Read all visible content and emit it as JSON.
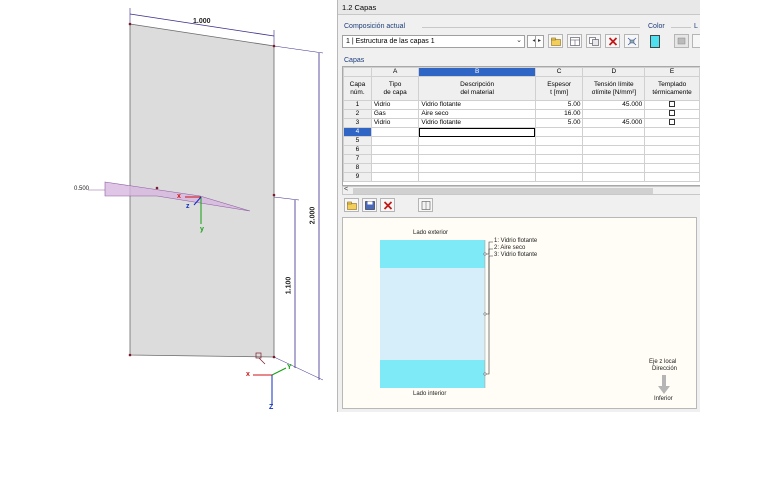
{
  "viewport": {
    "dim_width": "1.000",
    "dim_height": "2.000",
    "dim_partial": "1.100",
    "dim_offset": "0.500",
    "axis_x": "x",
    "axis_y": "y",
    "axis_z": "z",
    "axis_x2": "x",
    "axis_y2": "Y",
    "axis_z2": "Z"
  },
  "dialog": {
    "title": "1.2 Capas",
    "composition_label": "Composición actual",
    "composition_value": "1 | Estructura de las capas 1",
    "color_label": "Color",
    "extra_label": "L",
    "layers_label": "Capas",
    "spin_left": "◂",
    "spin_right": "▸",
    "combo_arrow": "⌄"
  },
  "table": {
    "col_letters": [
      "A",
      "B",
      "C",
      "D",
      "E"
    ],
    "header_row": {
      "rownum": "Capa\nnúm.",
      "a": "Tipo\nde capa",
      "b": "Descripción\ndel material",
      "c": "Espesor\nt [mm]",
      "d": "Tensión límite\nσlímite [N/mm²]",
      "e": "Templado\ntérmicamente"
    },
    "rows": [
      {
        "num": "1",
        "type": "Vidrio",
        "desc": "Vidrio flotante",
        "thick": "5.00",
        "stress": "45.000",
        "tempered": "false"
      },
      {
        "num": "2",
        "type": "Gas",
        "desc": "Aire seco",
        "thick": "16.00",
        "stress": "",
        "tempered": "false"
      },
      {
        "num": "3",
        "type": "Vidrio",
        "desc": "Vidrio flotante",
        "thick": "5.00",
        "stress": "45.000",
        "tempered": "false"
      },
      {
        "num": "4",
        "type": "",
        "desc": "",
        "thick": "",
        "stress": "",
        "tempered": ""
      },
      {
        "num": "5",
        "type": "",
        "desc": "",
        "thick": "",
        "stress": "",
        "tempered": ""
      },
      {
        "num": "6",
        "type": "",
        "desc": "",
        "thick": "",
        "stress": "",
        "tempered": ""
      },
      {
        "num": "7",
        "type": "",
        "desc": "",
        "thick": "",
        "stress": "",
        "tempered": ""
      },
      {
        "num": "8",
        "type": "",
        "desc": "",
        "thick": "",
        "stress": "",
        "tempered": ""
      },
      {
        "num": "9",
        "type": "",
        "desc": "",
        "thick": "",
        "stress": "",
        "tempered": ""
      }
    ],
    "scroll_left": "<"
  },
  "preview": {
    "exterior_label": "Lado exterior",
    "interior_label": "Lado interior",
    "legend": [
      "1: Vidrio flotante",
      "2: Aire seco",
      "3: Vidrio flotante"
    ],
    "axis_caption_1": "Eje z local",
    "axis_caption_2": "Dirección",
    "axis_caption_3": "Inferior"
  },
  "colors": {
    "glass": "#7ee9f7",
    "gas": "#d6eefa",
    "selection": "#2f65c4",
    "dimension": "#3a2a8a",
    "plane": "#d8b8e0"
  }
}
